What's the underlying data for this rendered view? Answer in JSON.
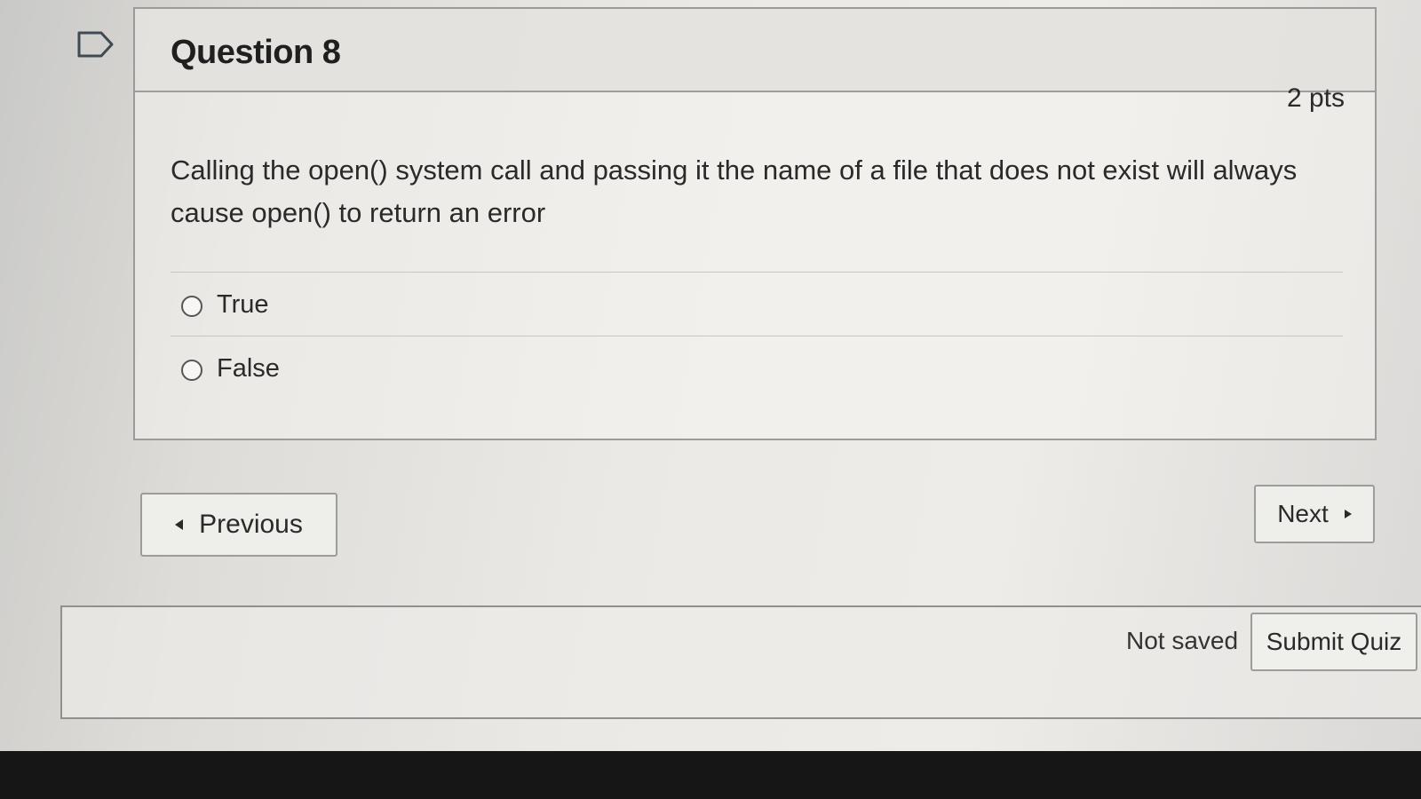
{
  "question": {
    "title": "Question 8",
    "points": "2 pts",
    "text": "Calling the open() system call and passing it the name of a file that does not exist will always cause open() to return an error",
    "answers": [
      {
        "label": "True",
        "selected": false
      },
      {
        "label": "False",
        "selected": false
      }
    ]
  },
  "navigation": {
    "previous_label": "Previous",
    "next_label": "Next"
  },
  "footer": {
    "save_status": "Not saved",
    "submit_label": "Submit Quiz"
  },
  "icons": {
    "flag": "flag-icon",
    "previous": "chevron-left-icon",
    "next": "chevron-right-icon"
  }
}
